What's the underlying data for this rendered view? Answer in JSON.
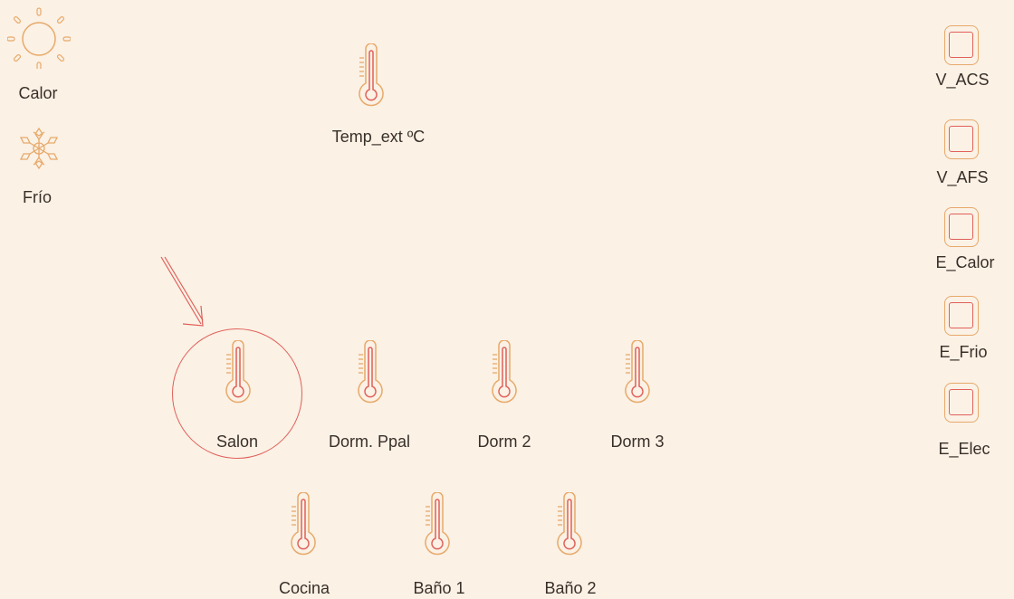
{
  "modes": {
    "calor": {
      "label": "Calor",
      "icon": "sun-icon"
    },
    "frio": {
      "label": "Frío",
      "icon": "snowflake-icon"
    }
  },
  "sensors": {
    "temp_ext": {
      "label": "Temp_ext ºC",
      "icon": "thermometer-icon"
    },
    "salon": {
      "label": "Salon",
      "icon": "thermometer-icon",
      "selected": true
    },
    "dorm_ppal": {
      "label": "Dorm. Ppal",
      "icon": "thermometer-icon"
    },
    "dorm2": {
      "label": "Dorm 2",
      "icon": "thermometer-icon"
    },
    "dorm3": {
      "label": "Dorm 3",
      "icon": "thermometer-icon"
    },
    "cocina": {
      "label": "Cocina",
      "icon": "thermometer-icon"
    },
    "bano1": {
      "label": "Baño 1",
      "icon": "thermometer-icon"
    },
    "bano2": {
      "label": "Baño 2",
      "icon": "thermometer-icon"
    }
  },
  "switches": [
    {
      "label": "V_ACS",
      "icon": "valve-square-icon"
    },
    {
      "label": "V_AFS",
      "icon": "valve-square-icon"
    },
    {
      "label": "E_Calor",
      "icon": "valve-square-icon"
    },
    {
      "label": "E_Frio",
      "icon": "valve-square-icon"
    },
    {
      "label": "E_Elec",
      "icon": "valve-square-icon"
    }
  ],
  "colors": {
    "background": "#fbf1e5",
    "outline_orange": "#e7a96a",
    "accent_red": "#e0605a",
    "text": "#3a2f28"
  }
}
